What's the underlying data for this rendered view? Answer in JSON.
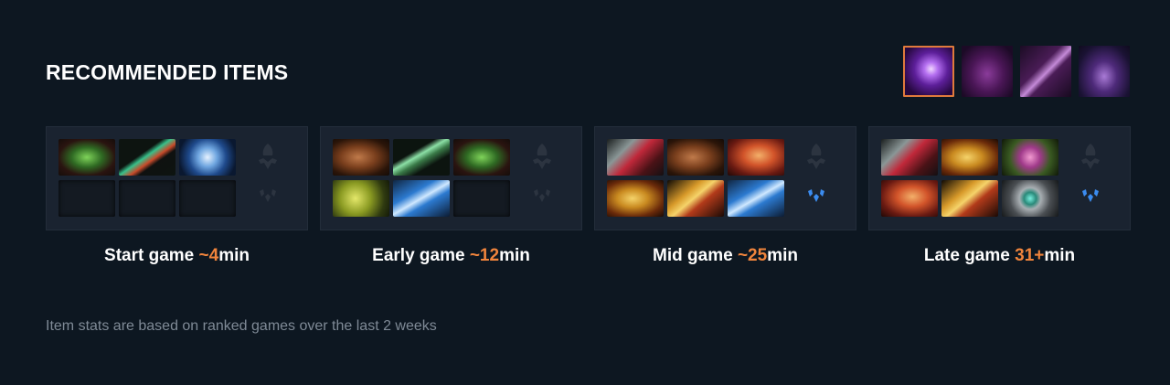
{
  "header": {
    "title": "RECOMMENDED ITEMS"
  },
  "abilities": [
    {
      "icon": "starstorm-ability-icon",
      "selected": true
    },
    {
      "icon": "mask-ability-icon",
      "selected": false
    },
    {
      "icon": "streak-ability-icon",
      "selected": false
    },
    {
      "icon": "circle-aura-ability-icon",
      "selected": false
    }
  ],
  "stages": [
    {
      "label_prefix": "Start game ",
      "time": "~4",
      "label_suffix": "min",
      "items": [
        "green-mantle",
        "red-tipped-wand",
        "blue-orb",
        "empty",
        "empty",
        "empty"
      ],
      "neutral_filled": false
    },
    {
      "label_prefix": "Early game ",
      "time": "~12",
      "label_suffix": "min",
      "items": [
        "brown-boots",
        "green-staff",
        "green-mantle",
        "yellow-wheel",
        "blue-sword",
        "empty"
      ],
      "neutral_filled": false
    },
    {
      "label_prefix": "Mid game ",
      "time": "~25",
      "label_suffix": "min",
      "items": [
        "red-spear",
        "brown-boots",
        "red-axe",
        "gold-helm",
        "gold-staff",
        "blue-sword"
      ],
      "neutral_filled": true
    },
    {
      "label_prefix": "Late game ",
      "time": "31+",
      "label_suffix": "min",
      "items": [
        "red-spear",
        "gold-helm",
        "purple-orb",
        "red-axe",
        "gold-staff",
        "silver-eye"
      ],
      "neutral_filled": true
    }
  ],
  "footnote": "Item stats are based on ranked games over the last 2 weeks",
  "colors": {
    "accent": "#f0843c",
    "background": "#0d1721",
    "panel": "#1a2330"
  }
}
